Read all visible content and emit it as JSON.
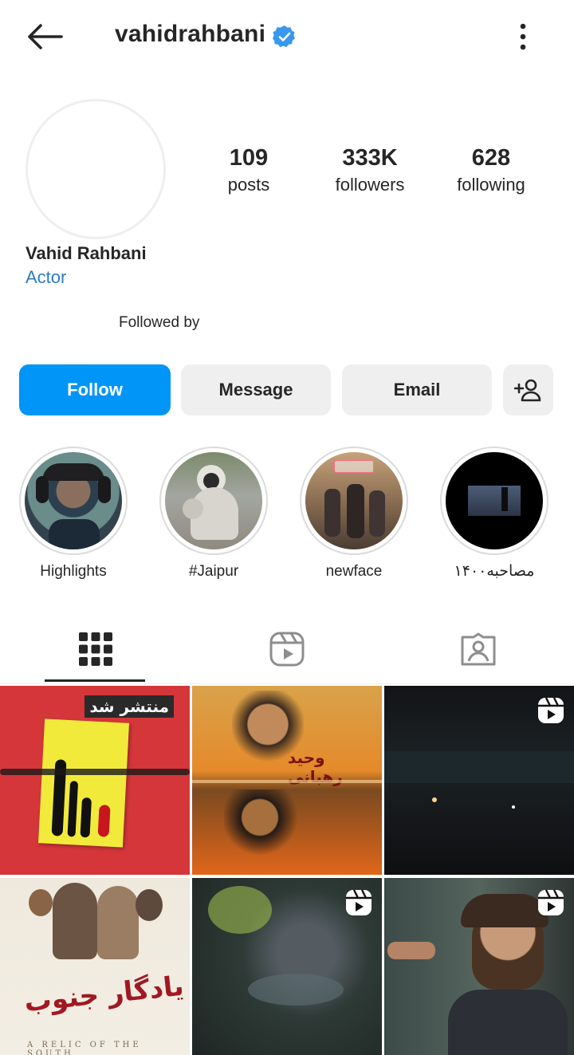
{
  "header": {
    "username": "vahidrahbani",
    "icons": [
      "back-arrow-icon",
      "verified-badge-icon",
      "more-vertical-icon"
    ]
  },
  "stats": {
    "posts": {
      "value": "109",
      "label": "posts"
    },
    "followers": {
      "value": "333K",
      "label": "followers"
    },
    "following": {
      "value": "628",
      "label": "following"
    }
  },
  "profile": {
    "display_name": "Vahid Rahbani",
    "category": "Actor",
    "followed_by": "Followed by"
  },
  "actions": {
    "follow": "Follow",
    "message": "Message",
    "email": "Email",
    "add_user_icon": "add-user-icon"
  },
  "highlights": [
    {
      "label": "Highlights"
    },
    {
      "label": "#Jaipur"
    },
    {
      "label": "newface"
    },
    {
      "label": "مصاحبه۱۴۰۰"
    }
  ],
  "tabs": [
    "grid-icon",
    "reels-icon",
    "tagged-icon"
  ],
  "posts": {
    "post1": {
      "title": "منتشر شد"
    },
    "post2": {
      "caption": "وحید رهبانی"
    },
    "post5": {
      "title": "یادگار جنوب",
      "subtitle": "A RELIC OF THE SOUTH"
    }
  },
  "colors": {
    "accent": "#0095f6",
    "category": "#2e7bbf",
    "button_bg": "#efefef"
  }
}
